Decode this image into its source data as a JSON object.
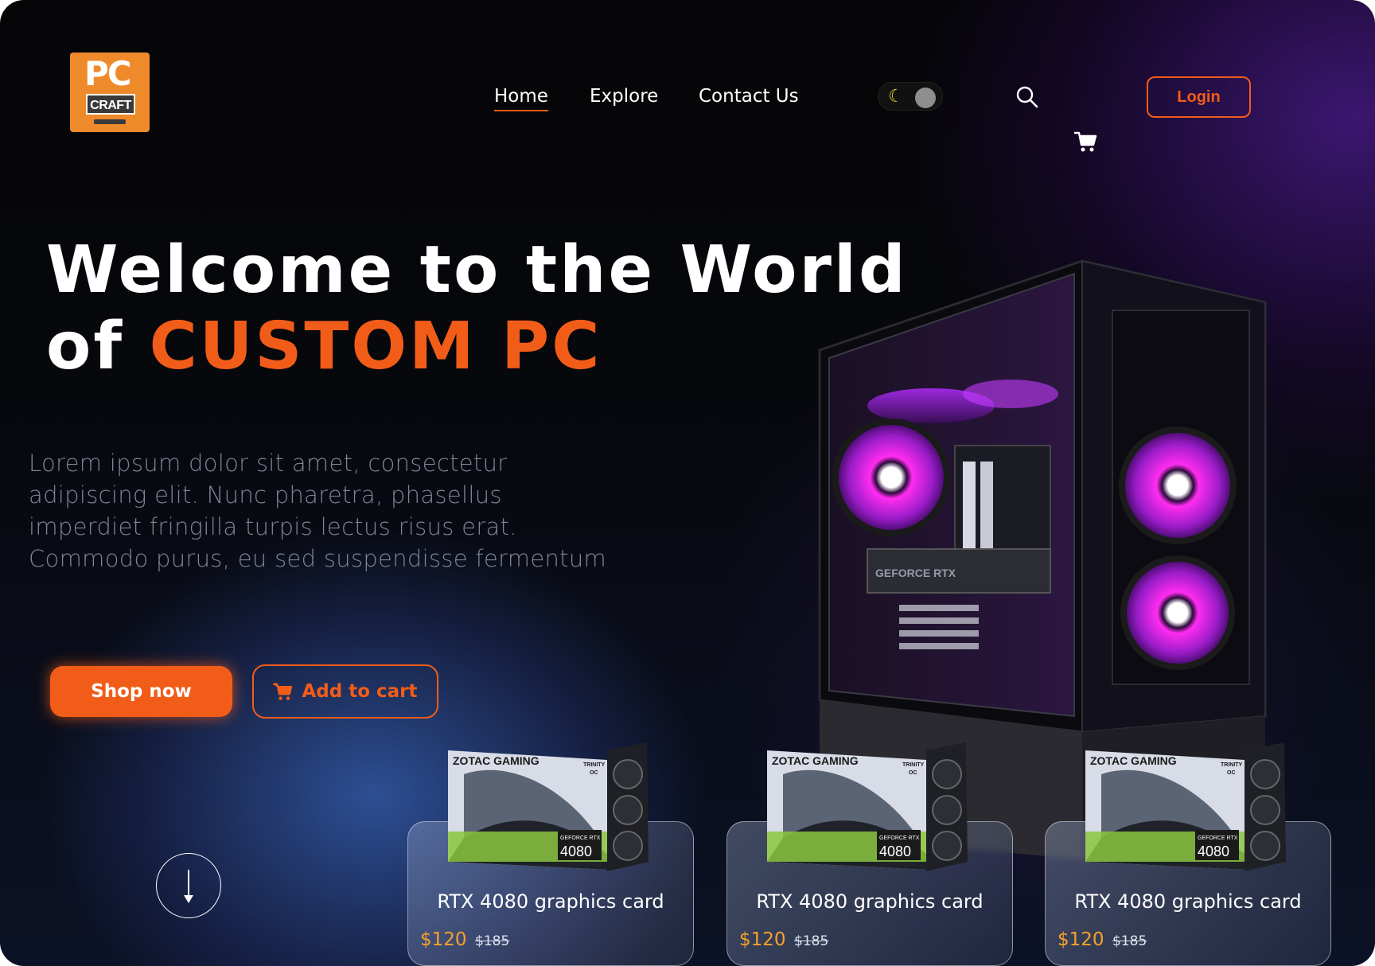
{
  "brand": {
    "logo_top": "PC",
    "logo_bottom": "CRAFT"
  },
  "nav": {
    "home": "Home",
    "explore": "Explore",
    "contact": "Contact Us"
  },
  "header": {
    "login_label": "Login",
    "theme_toggle": "dark-mode",
    "search_icon": "search-icon",
    "cart_icon": "cart-icon"
  },
  "hero": {
    "title_line1": "Welcome to the World",
    "title_of": "of ",
    "title_accent": "CUSTOM PC",
    "description": "Lorem ipsum dolor sit amet, consectetur adipiscing elit. Nunc pharetra, phasellus imperdiet fringilla turpis lectus risus erat. Commodo purus, eu sed suspendisse fermentum",
    "shop_label": "Shop now",
    "add_cart_label": "Add to cart"
  },
  "gpu_box": {
    "brand": "ZOTAC GAMING",
    "badge": "TRINITY",
    "badge2": "OC",
    "series": "GEFORCE RTX",
    "model": "4080"
  },
  "case_label": "GEFORCE RTX",
  "products": [
    {
      "name": "RTX 4080 graphics card",
      "price": "$120",
      "old_price": "$185"
    },
    {
      "name": "RTX 4080 graphics card",
      "price": "$120",
      "old_price": "$185"
    },
    {
      "name": "RTX 4080 graphics card",
      "price": "$120",
      "old_price": "$185"
    }
  ],
  "colors": {
    "accent": "#f25c19",
    "price": "#f6a22b",
    "background": "#07080c"
  }
}
